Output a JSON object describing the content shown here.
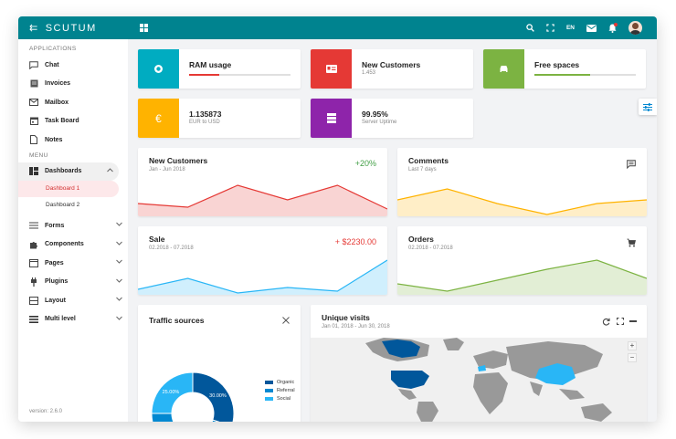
{
  "app": {
    "brand": "SCUTUM",
    "lang": "EN",
    "version": "version: 2.6.0"
  },
  "colors": {
    "topbar": "#00838f",
    "teal": "#00acc1",
    "red": "#e53935",
    "green": "#7cb342",
    "amber": "#ffb300",
    "purple": "#8e24aa",
    "blue": "#0288d1"
  },
  "sidebar": {
    "applications_title": "APPLICATIONS",
    "apps": [
      {
        "label": "Chat",
        "icon": "chat-icon"
      },
      {
        "label": "Invoices",
        "icon": "invoice-icon"
      },
      {
        "label": "Mailbox",
        "icon": "mail-icon"
      },
      {
        "label": "Task Board",
        "icon": "calendar-icon"
      },
      {
        "label": "Notes",
        "icon": "note-icon"
      }
    ],
    "menu_title": "MENU",
    "menu": [
      {
        "label": "Dashboards",
        "icon": "dashboard-icon",
        "expanded": true
      },
      {
        "label": "Forms",
        "icon": "form-icon"
      },
      {
        "label": "Components",
        "icon": "puzzle-icon"
      },
      {
        "label": "Pages",
        "icon": "page-icon"
      },
      {
        "label": "Plugins",
        "icon": "plug-icon"
      },
      {
        "label": "Layout",
        "icon": "layout-icon"
      },
      {
        "label": "Multi level",
        "icon": "list-icon"
      }
    ],
    "dashboards": [
      "Dashboard 1",
      "Dashboard 2"
    ]
  },
  "stats": {
    "ram": {
      "label": "RAM usage",
      "progress": 0.3
    },
    "customers": {
      "label": "New Customers",
      "value": "1.453"
    },
    "spaces": {
      "label": "Free spaces",
      "progress": 0.55
    },
    "eur": {
      "value": "1.135873",
      "label": "EUR to USD",
      "symbol": "€"
    },
    "uptime": {
      "value": "99.95%",
      "label": "Server Uptime"
    }
  },
  "charts": {
    "customers": {
      "title": "New Customers",
      "sub": "Jan - Jun 2018",
      "value": "+20%"
    },
    "comments": {
      "title": "Comments",
      "sub": "Last 7 days"
    },
    "sale": {
      "title": "Sale",
      "sub": "02.2018 - 07.2018",
      "value": "+ $2230.00"
    },
    "orders": {
      "title": "Orders",
      "sub": "02.2018 - 07.2018"
    },
    "traffic": {
      "title": "Traffic sources"
    },
    "visits": {
      "title": "Unique visits",
      "sub": "Jan 01, 2018 - Jun 30, 2018"
    }
  },
  "chart_data": [
    {
      "type": "area",
      "name": "customers",
      "values": [
        3,
        2,
        8,
        4,
        8,
        1.5
      ],
      "color": "#e53935",
      "ylim": [
        0,
        10
      ]
    },
    {
      "type": "area",
      "name": "comments",
      "values": [
        4,
        7,
        3,
        0,
        3,
        4
      ],
      "color": "#ffb300",
      "ylim": [
        0,
        10
      ]
    },
    {
      "type": "area",
      "name": "sale",
      "values": [
        1,
        4,
        0,
        1.5,
        0.5,
        9
      ],
      "color": "#29b6f6",
      "ylim": [
        0,
        10
      ]
    },
    {
      "type": "area",
      "name": "orders",
      "values": [
        2.5,
        0.5,
        3.5,
        6.5,
        9,
        4
      ],
      "color": "#7cb342",
      "ylim": [
        0,
        10
      ]
    },
    {
      "type": "pie",
      "name": "traffic",
      "categories": [
        "Organic",
        "Referral",
        "Social"
      ],
      "values": [
        30,
        45,
        25
      ],
      "labels": [
        "30.00%",
        "",
        "25.00%"
      ],
      "colors": [
        "#01579b",
        "#0288d1",
        "#29b6f6"
      ]
    }
  ]
}
